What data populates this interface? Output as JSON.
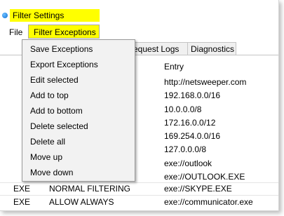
{
  "window": {
    "title": "Filter Settings"
  },
  "menubar": {
    "file": "File",
    "filter_exceptions": "Filter Exceptions"
  },
  "tabs": [
    {
      "label": "equest Logs"
    },
    {
      "label": "Diagnostics"
    }
  ],
  "table": {
    "entry_header": "Entry",
    "entries": [
      "http://netsweeper.com",
      "192.168.0.0/16",
      "10.0.0.0/8",
      "172.16.0.0/12",
      "169.254.0.0/16",
      "127.0.0.0/8",
      "exe://outlook",
      "exe://OUTLOOK.EXE"
    ],
    "visible_rows": [
      {
        "type": "EXE",
        "mode": "NORMAL FILTERING",
        "entry": "exe://SKYPE.EXE"
      },
      {
        "type": "EXE",
        "mode": "ALLOW ALWAYS",
        "entry": "exe://communicator.exe"
      }
    ]
  },
  "dropdown": {
    "items": [
      "Save Exceptions",
      "Export Exceptions",
      "Edit selected",
      "Add to top",
      "Add to bottom",
      "Delete selected",
      "Delete all",
      "Move up",
      "Move down"
    ]
  },
  "colors": {
    "highlight": "#ffff00",
    "menu_bg": "#f2f2f2",
    "tab_bg": "#f0f0f0"
  }
}
